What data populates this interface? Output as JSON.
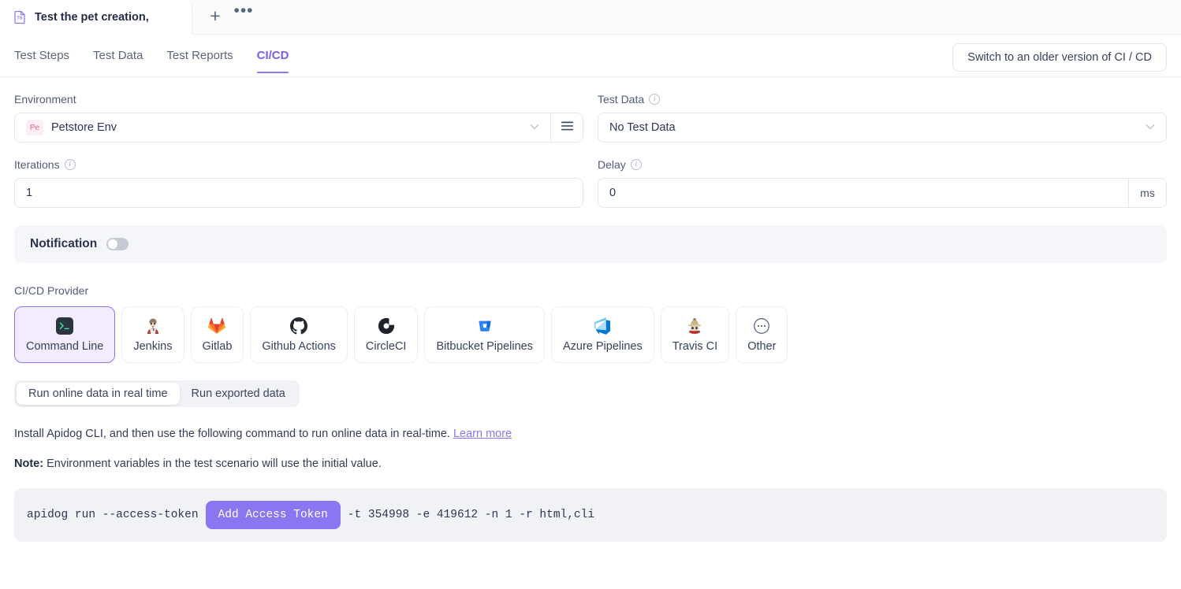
{
  "window": {
    "doc_tab": {
      "title": "Test the pet creation,",
      "icon": "test-scenario-ts-icon"
    },
    "new_tab_icon": "plus-icon",
    "more_tab_icon": "ellipsis-icon"
  },
  "subtabs": {
    "items": [
      {
        "label": "Test Steps",
        "active": false
      },
      {
        "label": "Test Data",
        "active": false
      },
      {
        "label": "Test Reports",
        "active": false
      },
      {
        "label": "CI/CD",
        "active": true
      }
    ],
    "switch_version_label": "Switch to an older version of CI / CD"
  },
  "form": {
    "environment": {
      "label": "Environment",
      "badge": "Pe",
      "value": "Petstore Env",
      "chevron_icon": "chevron-down-icon",
      "menu_icon": "hamburger-menu-icon"
    },
    "test_data": {
      "label": "Test Data",
      "info_icon": "info-icon",
      "value": "No Test Data",
      "chevron_icon": "chevron-down-icon"
    },
    "iterations": {
      "label": "Iterations",
      "info_icon": "info-icon",
      "value": "1"
    },
    "delay": {
      "label": "Delay",
      "info_icon": "info-icon",
      "value": "0",
      "unit": "ms"
    }
  },
  "notification": {
    "title": "Notification",
    "enabled": false
  },
  "providers": {
    "label": "CI/CD Provider",
    "items": [
      {
        "label": "Command Line",
        "icon": "terminal-icon",
        "selected": true
      },
      {
        "label": "Jenkins",
        "icon": "jenkins-butler-icon",
        "selected": false
      },
      {
        "label": "Gitlab",
        "icon": "gitlab-fox-icon",
        "selected": false
      },
      {
        "label": "Github Actions",
        "icon": "github-octocat-icon",
        "selected": false
      },
      {
        "label": "CircleCI",
        "icon": "circleci-icon",
        "selected": false
      },
      {
        "label": "Bitbucket Pipelines",
        "icon": "bitbucket-icon",
        "selected": false
      },
      {
        "label": "Azure Pipelines",
        "icon": "azure-devops-icon",
        "selected": false
      },
      {
        "label": "Travis CI",
        "icon": "travis-ci-icon",
        "selected": false
      },
      {
        "label": "Other",
        "icon": "ellipsis-circle-icon",
        "selected": false
      }
    ]
  },
  "run_mode": {
    "options": [
      {
        "label": "Run online data in real time",
        "active": true
      },
      {
        "label": "Run exported data",
        "active": false
      }
    ]
  },
  "description": {
    "text": "Install Apidog CLI, and then use the following command to run online data in real-time.",
    "link_label": "Learn more",
    "note_prefix": "Note:",
    "note_text": " Environment variables in the test scenario will use the initial value."
  },
  "command": {
    "prefix": "apidog run --access-token",
    "token_button_label": "Add Access Token",
    "suffix": "-t 354998 -e 419612 -n 1 -r html,cli"
  },
  "colors": {
    "accent_purple": "#8b75f0",
    "selected_card_bg": "#f2ecfe",
    "panel_gray": "#f1f2f6",
    "border": "#e5e7ec",
    "text": "#36415c"
  }
}
